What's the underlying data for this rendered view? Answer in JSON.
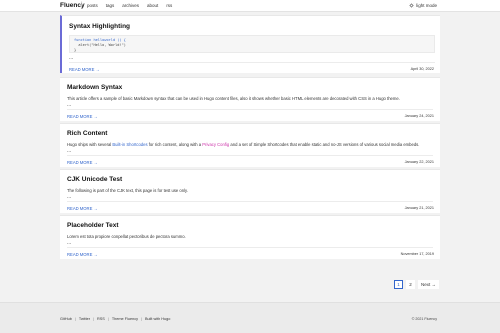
{
  "header": {
    "brand": "Fluency",
    "brand_sep": "|",
    "nav": [
      "posts",
      "tags",
      "archives",
      "about",
      "rss"
    ],
    "mode_label": "light mode",
    "mode_icon": "sun-icon"
  },
  "posts": [
    {
      "title": "Syntax Highlighting",
      "code_lines": [
        "function helloworld () {",
        "  alert(\"Hello, World!\")",
        "}"
      ],
      "dots": "...",
      "read_more": "READ MORE →",
      "date": "April 30, 2022"
    },
    {
      "title": "Markdown Syntax",
      "summary": "This article offers a sample of basic Markdown syntax that can be used in Hugo content files, also it shows whether basic HTML elements are decorated with CSS in a Hugo theme.",
      "dots": "...",
      "read_more": "READ MORE →",
      "date": "January 24, 2021"
    },
    {
      "title": "Rich Content",
      "summary_parts": [
        "Hugo ships with several ",
        "Built-in Shortcodes",
        " for rich content, along with a ",
        "Privacy Config",
        " and a set of Simple Shortcodes that enable static and no-JS versions of various social media embeds."
      ],
      "dots": "...",
      "read_more": "READ MORE →",
      "date": "January 22, 2021"
    },
    {
      "title": "CJK Unicode Test",
      "summary": "The following is part of the CJK text, this page is for test use only.",
      "dots": "...",
      "read_more": "READ MORE →",
      "date": "January 21, 2021"
    },
    {
      "title": "Placeholder Text",
      "summary": "Lorem est tota propiore conpellat pectoribus de pectora summo.",
      "dots": "...",
      "read_more": "READ MORE →",
      "date": "November 17, 2019"
    }
  ],
  "pagination": {
    "pages": [
      "1",
      "2"
    ],
    "current": "1",
    "next_label": "Next →"
  },
  "footer": {
    "links": [
      "GitHub",
      "Twitter",
      "RSS",
      "Theme Fluency",
      "Built with Hugo"
    ],
    "separator": "|",
    "copyright": "© 2021 Fluency"
  },
  "colors": {
    "accent": "#3366cc",
    "featured_border": "#6b6bd6",
    "link_pink": "#cc33aa"
  }
}
